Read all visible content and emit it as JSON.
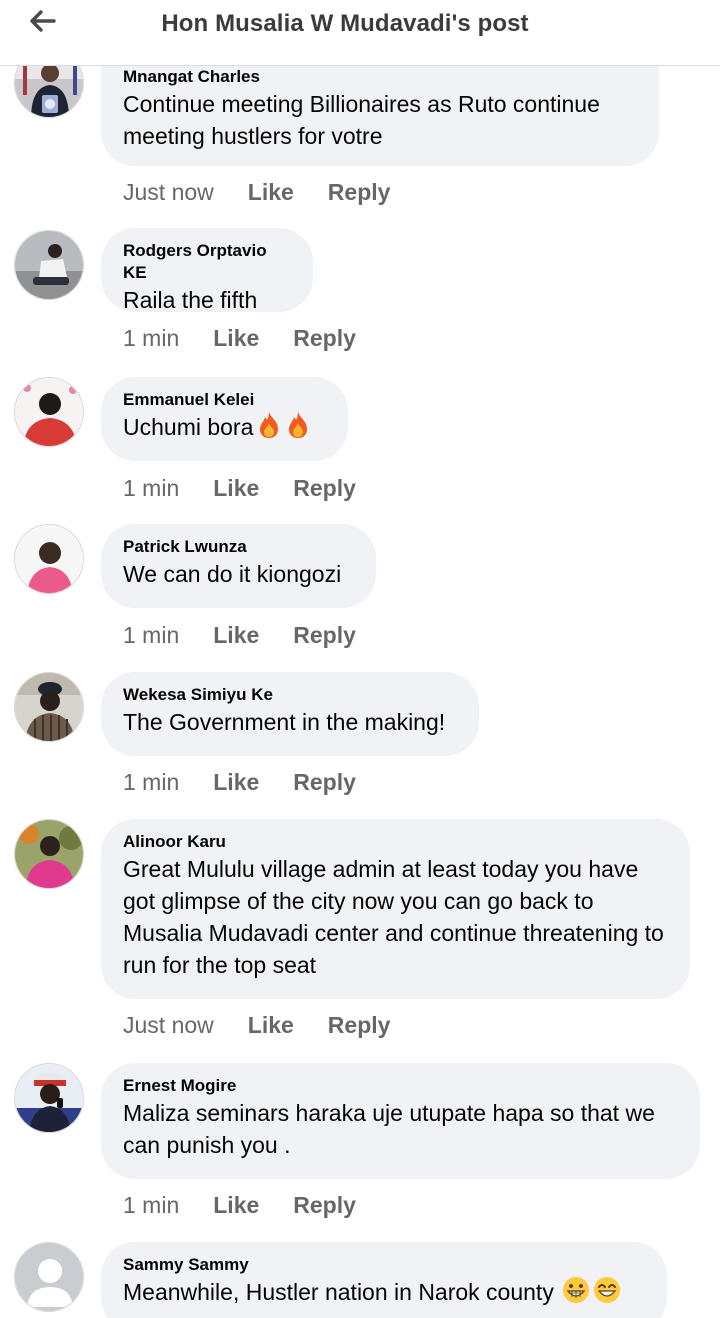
{
  "header": {
    "title": "Hon Musalia W Mudavadi's post"
  },
  "comments": [
    {
      "author": "Mnangat Charles",
      "text": "Continue  meeting  Billionaires as Ruto continue meeting  hustlers for votre",
      "time": "Just now",
      "like": "Like",
      "reply": "Reply"
    },
    {
      "author": "Rodgers Orptavio KE",
      "text": "Raila the fifth",
      "time": "1 min",
      "like": "Like",
      "reply": "Reply"
    },
    {
      "author": "Emmanuel Kelei",
      "text": "Uchumi bora",
      "time": "1 min",
      "like": "Like",
      "reply": "Reply"
    },
    {
      "author": "Patrick Lwunza",
      "text": "We can do it kiongozi",
      "time": "1 min",
      "like": "Like",
      "reply": "Reply"
    },
    {
      "author": "Wekesa Simiyu Ke",
      "text": "The Government in the making!",
      "time": "1 min",
      "like": "Like",
      "reply": "Reply"
    },
    {
      "author": "Alinoor Karu",
      "text": "Great Mululu village admin at least today you have got glimpse of the city now you can go back to Musalia Mudavadi center and continue threatening to run for the top seat",
      "time": "Just now",
      "like": "Like",
      "reply": "Reply"
    },
    {
      "author": "Ernest Mogire",
      "text": "Maliza seminars haraka uje utupate hapa so that we can punish you .",
      "time": "1 min",
      "like": "Like",
      "reply": "Reply"
    },
    {
      "author": "Sammy Sammy",
      "text": "Meanwhile, Hustler nation in Narok county"
    }
  ],
  "colors": {
    "bubble": "#f0f2f5",
    "meta_text": "#65676b",
    "header_text": "#3a3b3c"
  },
  "icons": {
    "back": "arrow-left-icon",
    "fire": "fire-emoji",
    "grin": "grinning-emoji",
    "default_avatar": "person-silhouette-icon"
  }
}
